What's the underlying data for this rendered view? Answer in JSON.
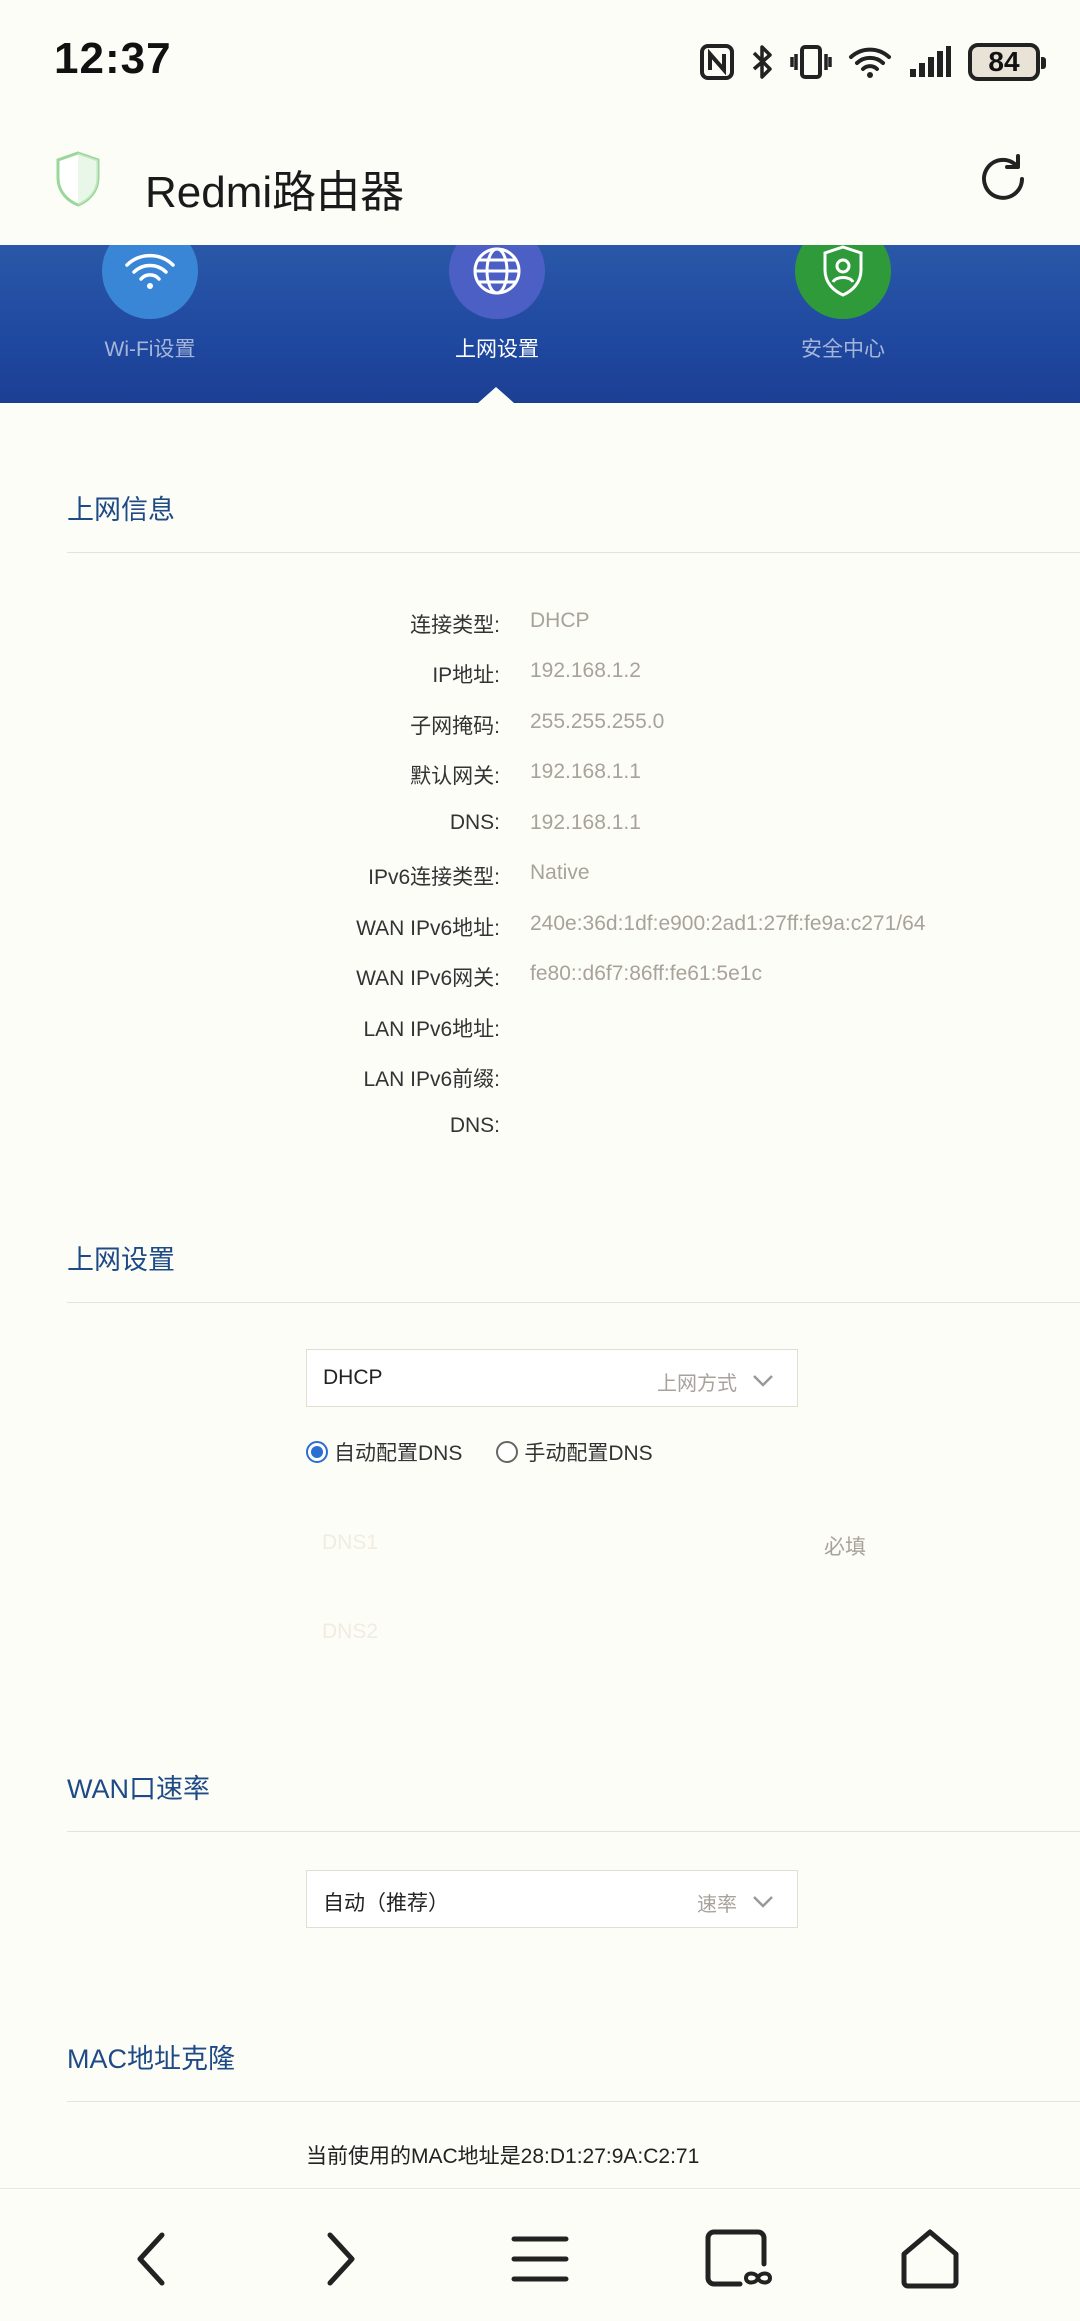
{
  "status_bar": {
    "time": "12:37",
    "battery": "84"
  },
  "app": {
    "title": "Redmi路由器"
  },
  "tabs": [
    {
      "label": "Wi-Fi设置",
      "icon": "wifi-icon",
      "color": "#3a86d6"
    },
    {
      "label": "上网设置",
      "icon": "globe-icon",
      "color": "#4c5fc4",
      "active": true
    },
    {
      "label": "安全中心",
      "icon": "shield-user-icon",
      "color": "#2f9a3a"
    }
  ],
  "internet_info": {
    "title": "上网信息",
    "rows": [
      {
        "key": "连接类型:",
        "value": "DHCP"
      },
      {
        "key": "IP地址:",
        "value": "192.168.1.2"
      },
      {
        "key": "子网掩码:",
        "value": "255.255.255.0"
      },
      {
        "key": "默认网关:",
        "value": "192.168.1.1"
      },
      {
        "key": "DNS:",
        "value": "192.168.1.1"
      },
      {
        "key": "IPv6连接类型:",
        "value": "Native"
      },
      {
        "key": "WAN IPv6地址:",
        "value": "240e:36d:1df:e900:2ad1:27ff:fe9a:c271/64"
      },
      {
        "key": "WAN IPv6网关:",
        "value": "fe80::d6f7:86ff:fe61:5e1c"
      },
      {
        "key": "LAN IPv6地址:",
        "value": ""
      },
      {
        "key": "LAN IPv6前缀:",
        "value": ""
      },
      {
        "key": "DNS:",
        "value": ""
      }
    ]
  },
  "internet_settings": {
    "title": "上网设置",
    "mode_value": "DHCP",
    "mode_hint": "上网方式",
    "dns_auto_label": "自动配置DNS",
    "dns_manual_label": "手动配置DNS",
    "dns1_placeholder": "DNS1",
    "dns1_required": "必填",
    "dns2_placeholder": "DNS2"
  },
  "wan_speed": {
    "title": "WAN口速率",
    "value": "自动（推荐）",
    "hint": "速率"
  },
  "mac_clone": {
    "title": "MAC地址克隆",
    "current_text": "当前使用的MAC地址是28:D1:27:9A:C2:71"
  },
  "colors": {
    "accent": "#1e4a86",
    "tabbar": "#1f48a0",
    "value_text": "#a8a29a"
  }
}
